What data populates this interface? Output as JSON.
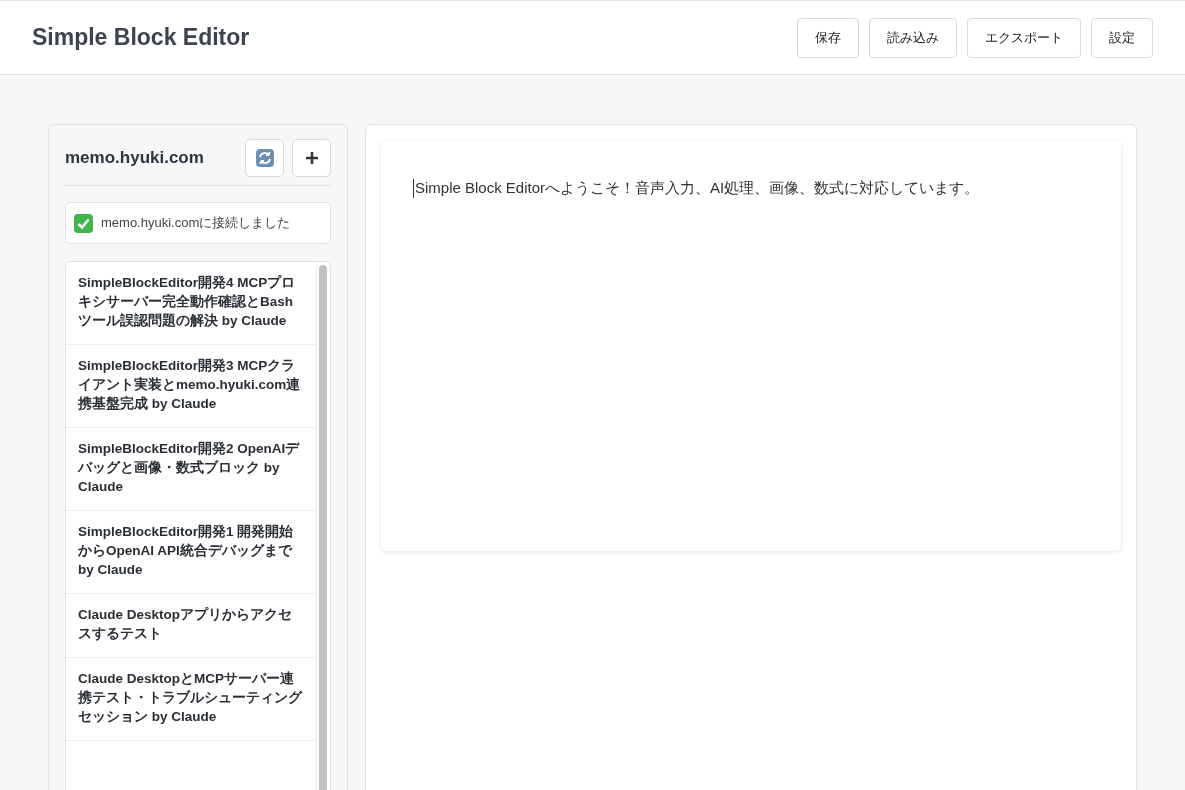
{
  "header": {
    "title": "Simple Block Editor",
    "buttons": [
      "保存",
      "読み込み",
      "エクスポート",
      "設定"
    ]
  },
  "sidebar": {
    "title": "memo.hyuki.com",
    "status": "memo.hyuki.comに接続しました",
    "items": [
      {
        "title": "SimpleBlockEditor開発4 MCPプロキシサーバー完全動作確認とBashツール誤認問題の解決 by Claude"
      },
      {
        "title": "SimpleBlockEditor開発3 MCPクライアント実装とmemo.hyuki.com連携基盤完成 by Claude"
      },
      {
        "title": "SimpleBlockEditor開発2 OpenAIデバッグと画像・数式ブロック by Claude"
      },
      {
        "title": "SimpleBlockEditor開発1 開発開始からOpenAI API統合デバッグまで by Claude"
      },
      {
        "title": "Claude Desktopアプリからアクセスするテスト"
      },
      {
        "title": "Claude DesktopとMCPサーバー連携テスト・トラブルシューティングセッション by Claude"
      }
    ]
  },
  "editor": {
    "blocks": [
      {
        "kind": "text",
        "text": "Simple Block Editorへようこそ！音声入力、AI処理、画像、数式に対応しています。"
      }
    ]
  }
}
